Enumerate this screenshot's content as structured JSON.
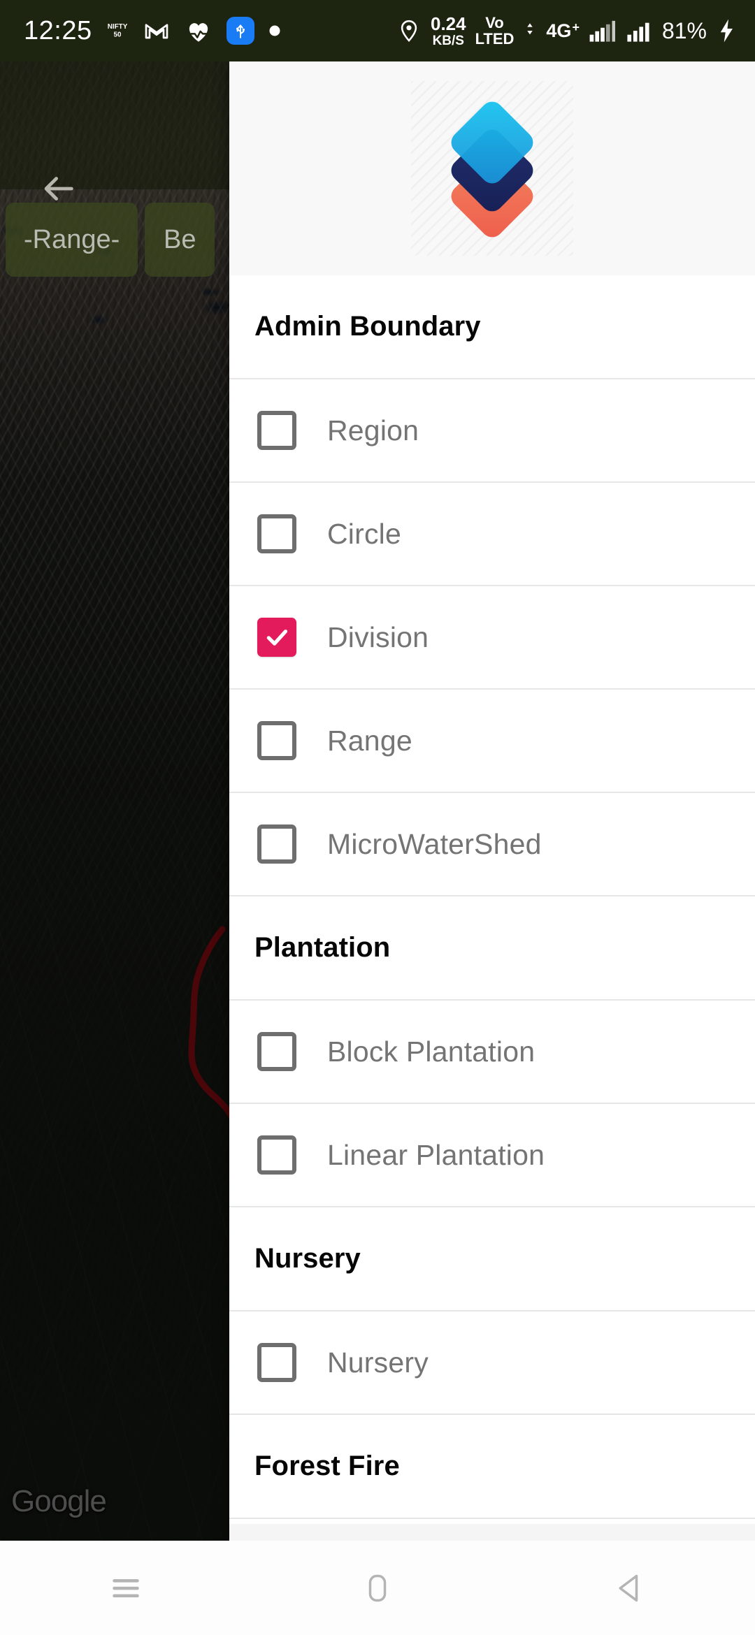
{
  "status_bar": {
    "time": "12:25",
    "left_icons": [
      "nifty-app-icon",
      "gmail-icon",
      "health-heart-icon",
      "usb-icon",
      "dot-indicator-icon"
    ],
    "location_icon": "location-pin-icon",
    "net_speed_value": "0.24",
    "net_speed_unit": "KB/S",
    "volte_line1": "Vo",
    "volte_line2": "LTED",
    "network_type": "4G",
    "network_plus": "+",
    "battery_percent": "81%",
    "charging_icon": "lightning-bolt-icon",
    "signal_icon": "signal-bars-icon"
  },
  "app_bar": {
    "back_icon": "arrow-left-icon",
    "chips": [
      {
        "label": "-Range-"
      },
      {
        "label": "Be"
      }
    ]
  },
  "map": {
    "watermark": "Google",
    "boundary_color": "#b41018",
    "overlay_name": "division-boundary-overlay"
  },
  "drawer": {
    "logo_name": "layers-stack-logo",
    "logo_colors": {
      "top": "#29b6e8",
      "middle": "#1f2f6e",
      "bottom": "#f0704f"
    },
    "accent_checked": "#e31b5d",
    "sections": [
      {
        "title": "Admin Boundary",
        "items": [
          {
            "label": "Region",
            "checked": false
          },
          {
            "label": "Circle",
            "checked": false
          },
          {
            "label": "Division",
            "checked": true
          },
          {
            "label": "Range",
            "checked": false
          },
          {
            "label": "MicroWaterShed",
            "checked": false
          }
        ]
      },
      {
        "title": "Plantation",
        "items": [
          {
            "label": "Block Plantation",
            "checked": false
          },
          {
            "label": "Linear Plantation",
            "checked": false
          }
        ]
      },
      {
        "title": "Nursery",
        "items": [
          {
            "label": "Nursery",
            "checked": false
          }
        ]
      },
      {
        "title": "Forest Fire",
        "items": []
      }
    ]
  },
  "nav_bar": {
    "buttons": [
      {
        "name": "recents-button",
        "icon": "hamburger-icon"
      },
      {
        "name": "home-button",
        "icon": "home-pill-icon"
      },
      {
        "name": "back-button",
        "icon": "triangle-back-icon"
      }
    ]
  }
}
